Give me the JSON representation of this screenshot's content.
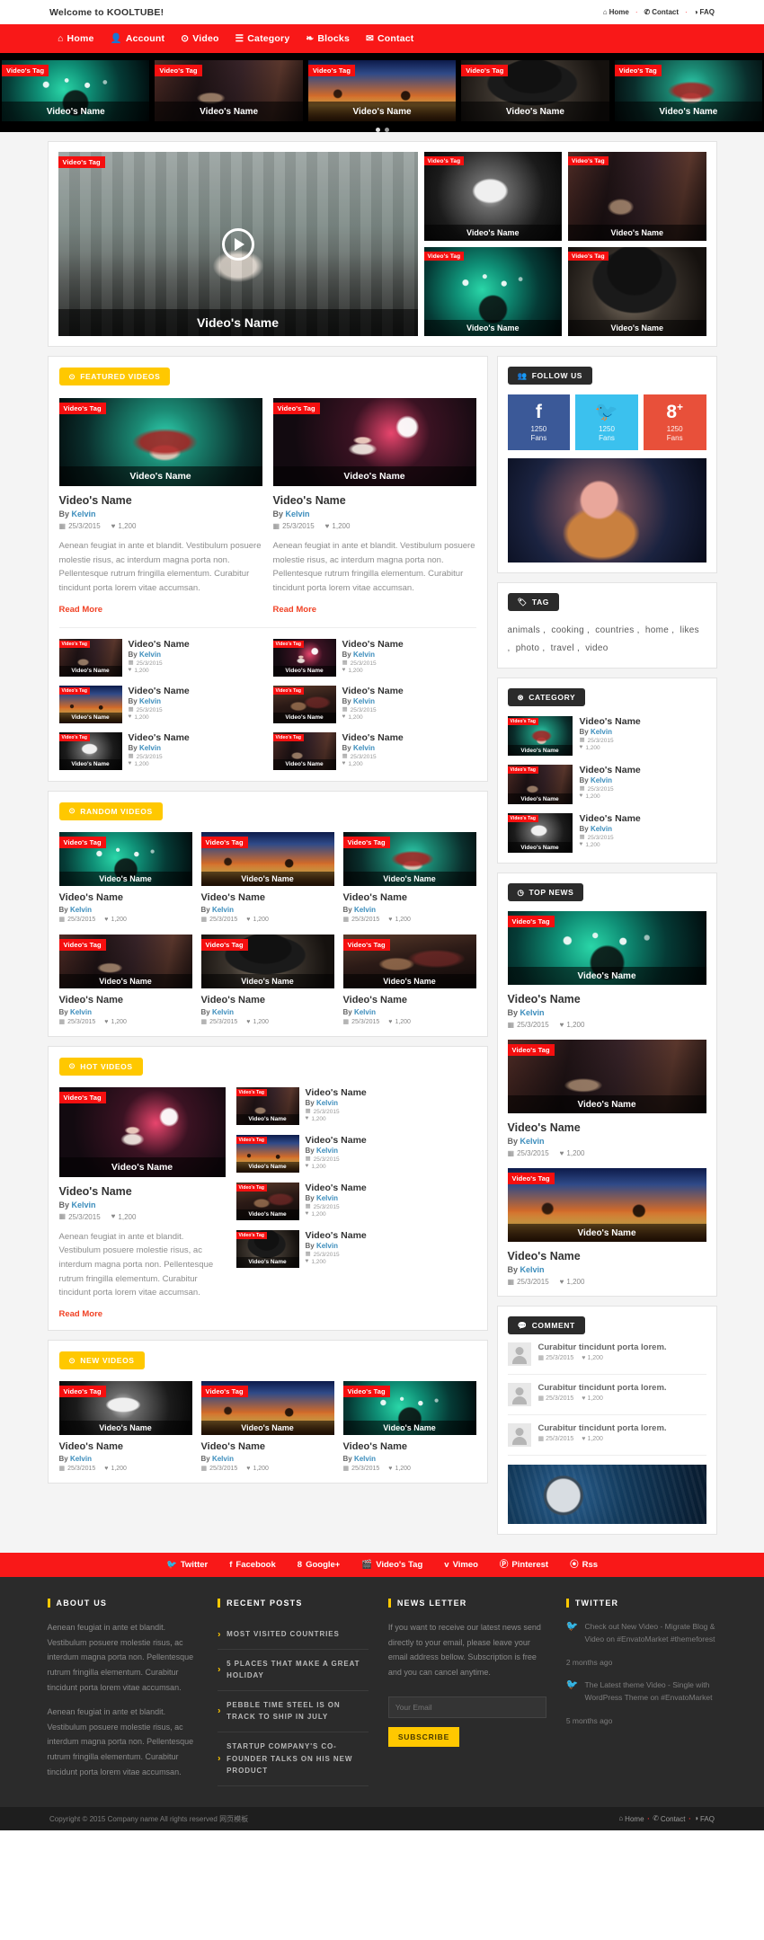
{
  "topbar": {
    "welcome": "Welcome to KOOLTUBE!",
    "links": [
      {
        "label": "Home",
        "icon": "home-icon"
      },
      {
        "label": "Contact",
        "icon": "phone-icon"
      },
      {
        "label": "FAQ",
        "icon": "question-icon"
      }
    ]
  },
  "nav": {
    "items": [
      {
        "label": "Home",
        "icon": "home-icon"
      },
      {
        "label": "Account",
        "icon": "user-icon"
      },
      {
        "label": "Video",
        "icon": "play-circle-icon"
      },
      {
        "label": "Category",
        "icon": "list-icon"
      },
      {
        "label": "Blocks",
        "icon": "blocks-icon"
      },
      {
        "label": "Contact",
        "icon": "envelope-icon"
      }
    ]
  },
  "carousel": {
    "items": [
      {
        "tag": "Video's Tag",
        "name": "Video's Name",
        "art": "ph-green"
      },
      {
        "tag": "Video's Tag",
        "name": "Video's Name",
        "art": "ph-goth"
      },
      {
        "tag": "Video's Tag",
        "name": "Video's Name",
        "art": "ph-sunset"
      },
      {
        "tag": "Video's Tag",
        "name": "Video's Name",
        "art": "ph-hat"
      },
      {
        "tag": "Video's Tag",
        "name": "Video's Name",
        "art": "ph-red"
      }
    ],
    "dots": 2,
    "active_dot": 0
  },
  "hero_panel": {
    "big": {
      "tag": "Video's Tag",
      "name": "Video's Name",
      "art": "ph-street"
    },
    "small": [
      {
        "tag": "Video's Tag",
        "name": "Video's Name",
        "art": "ph-mask"
      },
      {
        "tag": "Video's Tag",
        "name": "Video's Name",
        "art": "ph-goth"
      },
      {
        "tag": "Video's Tag",
        "name": "Video's Name",
        "art": "ph-green"
      },
      {
        "tag": "Video's Tag",
        "name": "Video's Name",
        "art": "ph-hat"
      }
    ]
  },
  "labels": {
    "by_prefix": "By",
    "author": "Kelvin",
    "date": "25/3/2015",
    "likes": "1,200",
    "read_more": "Read More",
    "tag_text": "Video's Tag",
    "video_name": "Video's Name",
    "description": "Aenean feugiat in ante et blandit. Vestibulum posuere molestie risus, ac interdum magna porta non. Pellentesque rutrum fringilla elementum. Curabitur tincidunt porta lorem vitae accumsan."
  },
  "sections": {
    "featured": {
      "title": "FEATURED VIDEOS",
      "icon": "video-badge-icon",
      "cards": [
        {
          "art": "ph-red"
        },
        {
          "art": "ph-tux"
        }
      ],
      "list_left": [
        {
          "art": "ph-goth"
        },
        {
          "art": "ph-sunset"
        },
        {
          "art": "ph-mask"
        }
      ],
      "list_right": [
        {
          "art": "ph-tux"
        },
        {
          "art": "ph-dance"
        },
        {
          "art": "ph-goth"
        }
      ]
    },
    "random": {
      "title": "RANDOM VIDEOS",
      "icon": "video-badge-icon",
      "row1": [
        {
          "art": "ph-green"
        },
        {
          "art": "ph-sunset"
        },
        {
          "art": "ph-red"
        }
      ],
      "row2": [
        {
          "art": "ph-goth"
        },
        {
          "art": "ph-hat"
        },
        {
          "art": "ph-dance"
        }
      ]
    },
    "hot": {
      "title": "HOT VIDEOS",
      "icon": "video-badge-icon",
      "feature": {
        "art": "ph-tux"
      },
      "list": [
        {
          "art": "ph-goth"
        },
        {
          "art": "ph-sunset"
        },
        {
          "art": "ph-dance"
        },
        {
          "art": "ph-hat"
        }
      ]
    },
    "new": {
      "title": "NEW VIDEOS",
      "icon": "video-badge-icon",
      "row": [
        {
          "art": "ph-mask"
        },
        {
          "art": "ph-sunset"
        },
        {
          "art": "ph-green"
        }
      ]
    }
  },
  "sidebar": {
    "follow": {
      "title": "Follow Us",
      "icon": "users-icon",
      "buttons": [
        {
          "network": "facebook",
          "glyph": "f",
          "count": "1250",
          "unit": "Fans",
          "color": "#3b5998"
        },
        {
          "network": "twitter",
          "glyph": "twitter-bird-icon",
          "count": "1250",
          "unit": "Fans",
          "color": "#3bc1ee"
        },
        {
          "network": "googleplus",
          "glyph": "8+",
          "count": "1250",
          "unit": "Fans",
          "color": "#e8503a"
        }
      ],
      "ad_art": "ph-sack"
    },
    "tag": {
      "title": "Tag",
      "icon": "tag-icon",
      "items": [
        "animals",
        "cooking",
        "countries",
        "home",
        "likes",
        "photo",
        "travel",
        "video"
      ]
    },
    "category": {
      "title": "Category",
      "icon": "category-icon",
      "items": [
        {
          "art": "ph-red"
        },
        {
          "art": "ph-goth"
        },
        {
          "art": "ph-mask"
        }
      ]
    },
    "topnews": {
      "title": "Top News",
      "icon": "clock-icon",
      "items": [
        {
          "art": "ph-green"
        },
        {
          "art": "ph-goth"
        },
        {
          "art": "ph-sunset"
        }
      ]
    },
    "comment": {
      "title": "Comment",
      "icon": "comment-icon",
      "items": [
        {
          "text": "Curabitur tincidunt porta lorem.",
          "date": "25/3/2015",
          "likes": "1,200"
        },
        {
          "text": "Curabitur tincidunt porta lorem.",
          "date": "25/3/2015",
          "likes": "1,200"
        },
        {
          "text": "Curabitur tincidunt porta lorem.",
          "date": "25/3/2015",
          "likes": "1,200"
        }
      ],
      "ad_art": "ph-disk"
    }
  },
  "footer_social": [
    {
      "label": "Twitter",
      "icon": "twitter-icon"
    },
    {
      "label": "Facebook",
      "icon": "facebook-icon"
    },
    {
      "label": "Google+",
      "icon": "googleplus-icon"
    },
    {
      "label": "Video's Tag",
      "icon": "video-icon"
    },
    {
      "label": "Vimeo",
      "icon": "vimeo-icon"
    },
    {
      "label": "Pinterest",
      "icon": "pinterest-icon"
    },
    {
      "label": "Rss",
      "icon": "rss-icon"
    }
  ],
  "footer": {
    "about": {
      "title": "ABOUT US",
      "p1": "Aenean feugiat in ante et blandit. Vestibulum posuere molestie risus, ac interdum magna porta non. Pellentesque rutrum fringilla elementum. Curabitur tincidunt porta lorem vitae accumsan.",
      "p2": "Aenean feugiat in ante et blandit. Vestibulum posuere molestie risus, ac interdum magna porta non. Pellentesque rutrum fringilla elementum. Curabitur tincidunt porta lorem vitae accumsan."
    },
    "recent": {
      "title": "RECENT POSTS",
      "posts": [
        "MOST VISITED COUNTRIES",
        "5 PLACES THAT MAKE A GREAT HOLIDAY",
        "PEBBLE TIME STEEL IS ON TRACK TO SHIP IN JULY",
        "STARTUP COMPANY'S CO-FOUNDER TALKS ON HIS NEW PRODUCT"
      ]
    },
    "newsletter": {
      "title": "NEWS LETTER",
      "text": "If you want to receive our latest news send directly to your email, please leave your email address bellow. Subscription is free and you can cancel anytime.",
      "placeholder": "Your Email",
      "button": "SUBSCRIBE"
    },
    "twitter": {
      "title": "TWITTER",
      "tweets": [
        {
          "text": "Check out New Video - Migrate Blog & Video on #EnvatoMarket #themeforest",
          "ago": "2 months ago"
        },
        {
          "text": "The Latest theme Video - Single with WordPress Theme on #EnvatoMarket",
          "ago": "5 months ago"
        }
      ]
    }
  },
  "copyright": {
    "text": "Copyright © 2015 Company name All rights reserved 网页模板",
    "links": [
      {
        "label": "Home",
        "icon": "home-icon"
      },
      {
        "label": "Contact",
        "icon": "phone-icon"
      },
      {
        "label": "FAQ",
        "icon": "question-icon"
      }
    ]
  }
}
